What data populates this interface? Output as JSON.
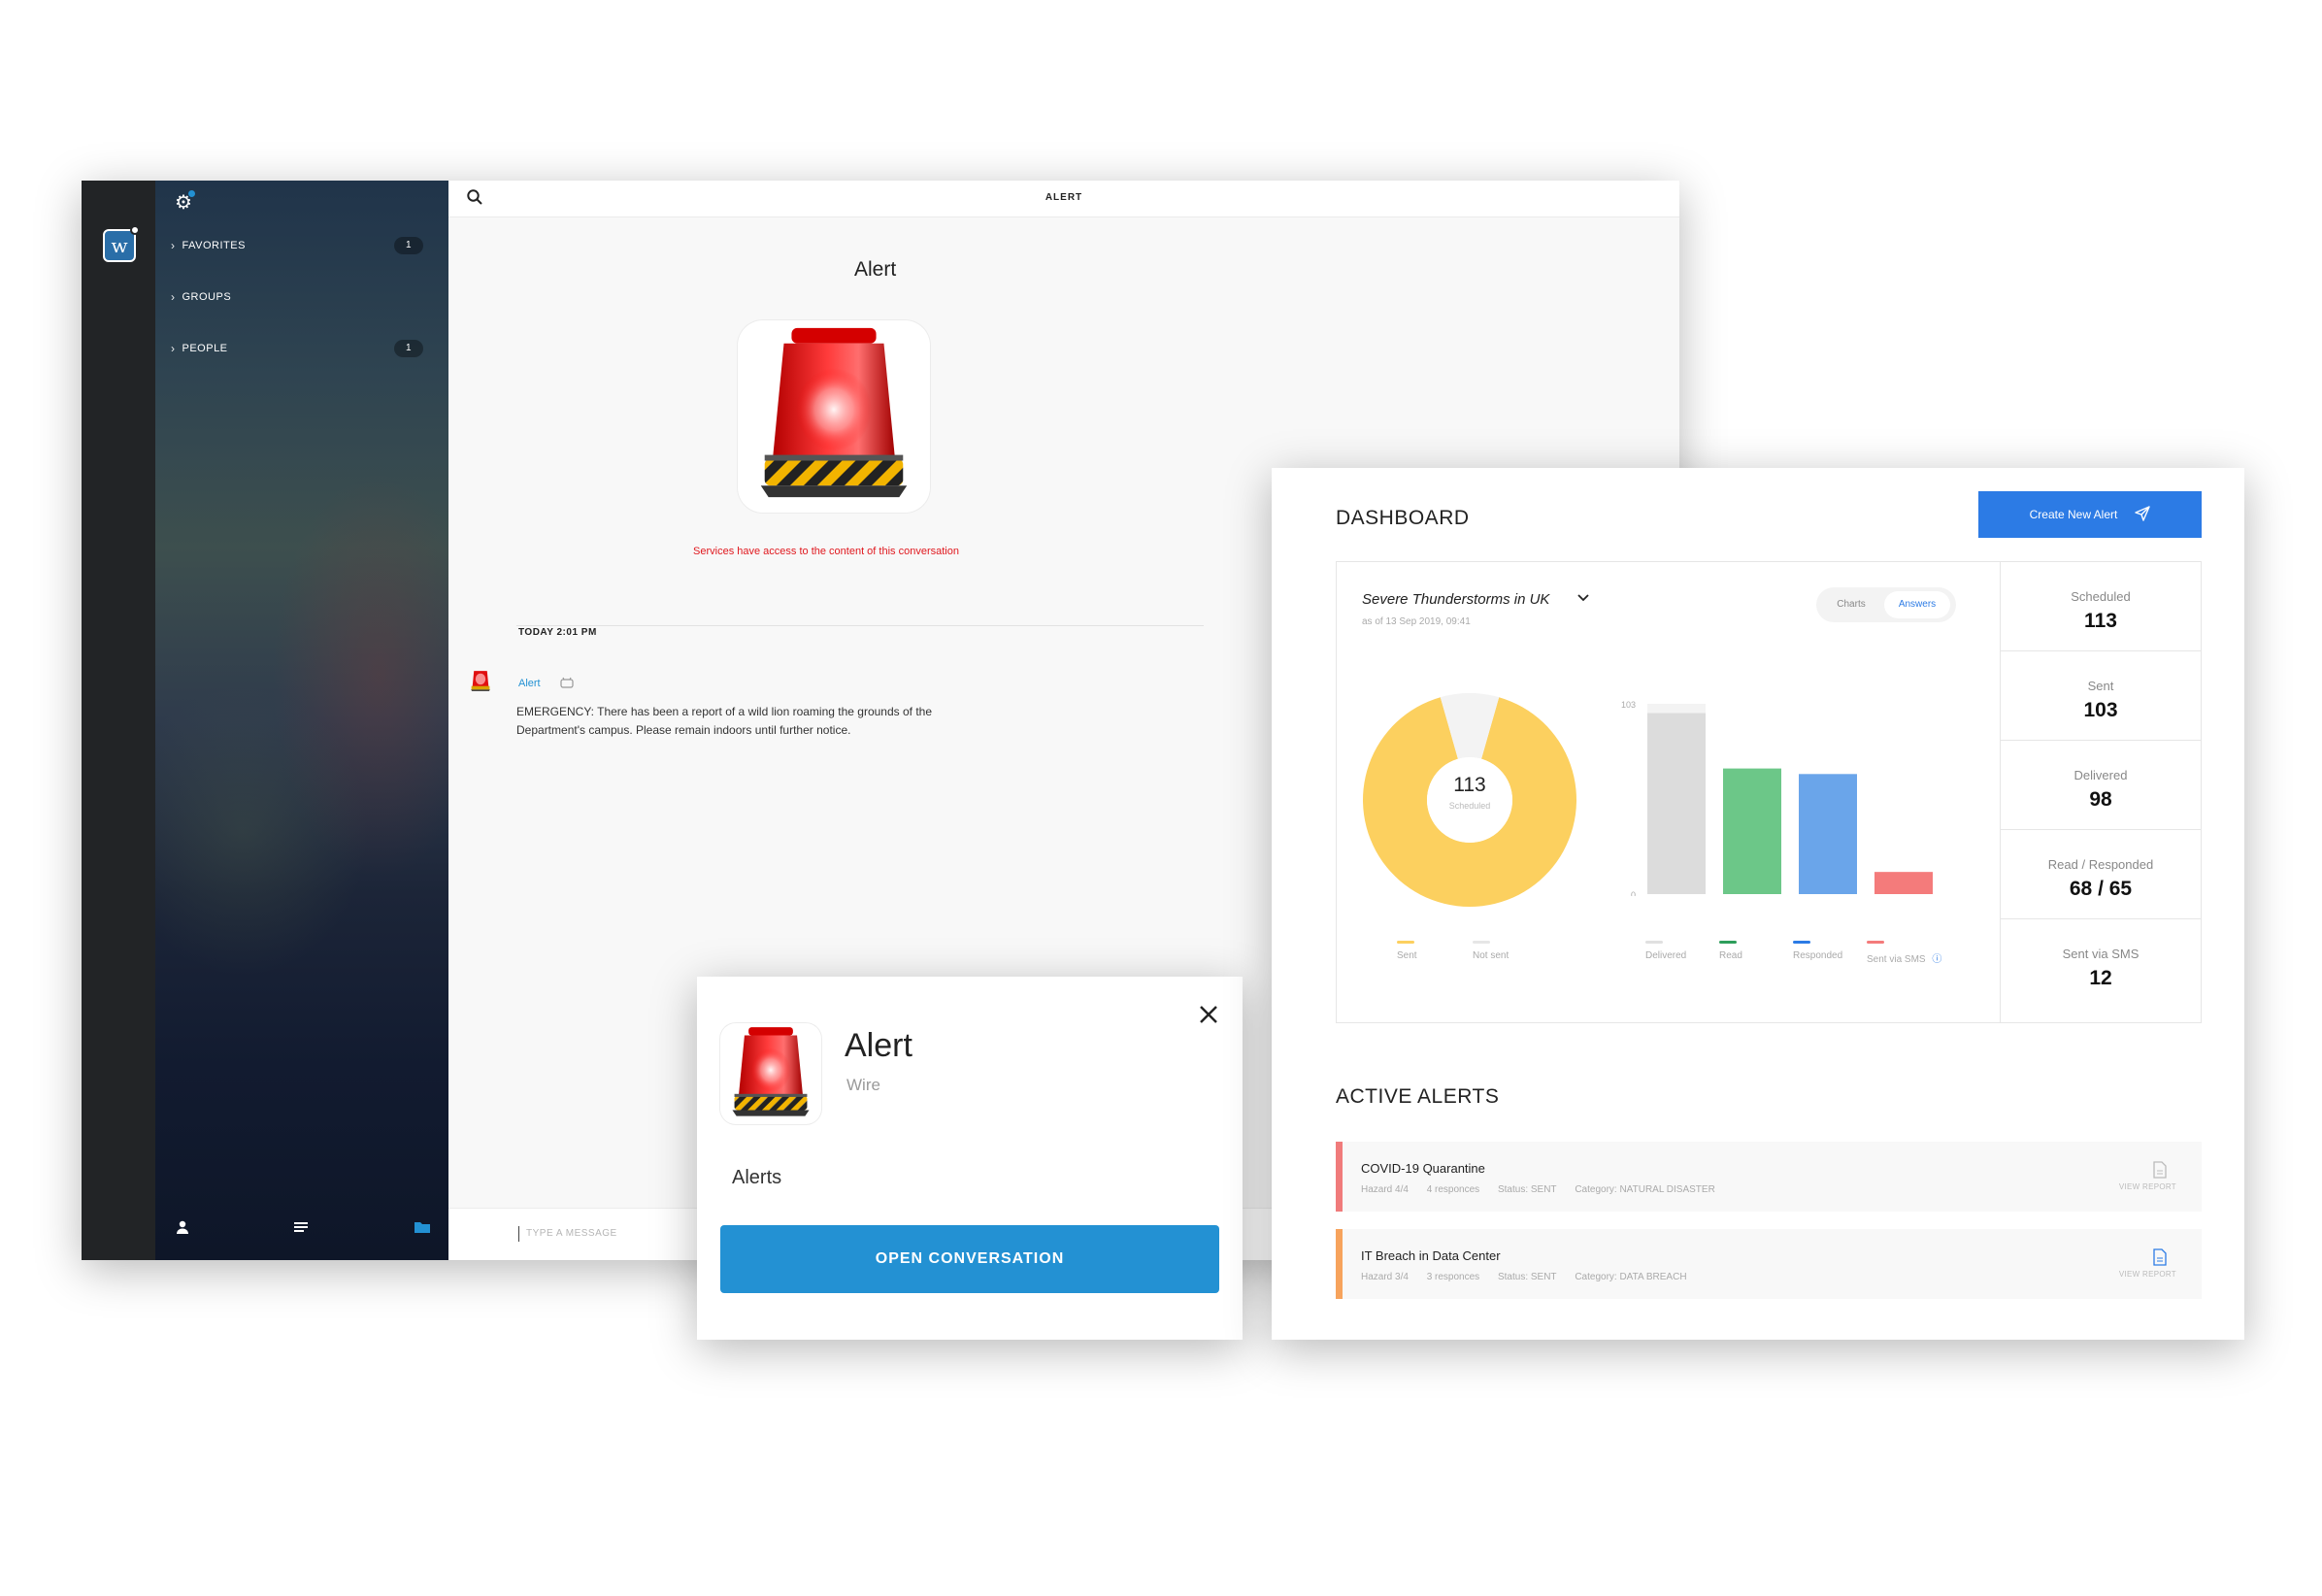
{
  "wire": {
    "logo_letter": "w",
    "sidebar": {
      "items": [
        {
          "label": "FAVORITES",
          "count": "1"
        },
        {
          "label": "GROUPS",
          "count": ""
        },
        {
          "label": "PEOPLE",
          "count": "1"
        }
      ],
      "bottom_icons": [
        "user-icon",
        "list-icon",
        "folder-icon"
      ]
    },
    "top_title": "ALERT",
    "conversation_name": "Alert",
    "services_note": "Services have access to the content of this conversation",
    "day_label": "TODAY 2:01 PM",
    "message": {
      "sender": "Alert",
      "text": "EMERGENCY: There has been a report of a wild lion roaming the grounds of the Department's campus. Please remain indoors until further notice."
    },
    "composer_placeholder": "TYPE A MESSAGE"
  },
  "popup": {
    "title": "Alert",
    "subtitle": "Wire",
    "label": "Alerts",
    "button": "OPEN CONVERSATION"
  },
  "dashboard": {
    "title": "DASHBOARD",
    "create_button": "Create New Alert",
    "colors": {
      "accent": "#2c7be5",
      "sent": "#fcd05f",
      "not_sent": "#f3f3f3",
      "read": "#6cc788",
      "responded": "#6aa5ea",
      "sms": "#f47b7b"
    },
    "event": {
      "title": "Severe Thunderstorms in UK",
      "subtitle": "as of 13 Sep 2019, 09:41",
      "toggle": [
        "Charts",
        "Answers"
      ],
      "active_toggle": "Answers"
    },
    "stats": [
      {
        "label": "Scheduled",
        "value": "113"
      },
      {
        "label": "Sent",
        "value": "103"
      },
      {
        "label": "Delivered",
        "value": "98"
      },
      {
        "label": "Read / Responded",
        "value": "68 / 65"
      },
      {
        "label": "Sent via SMS",
        "value": "12"
      }
    ],
    "donut_center": {
      "value": "113",
      "label": "Scheduled"
    },
    "donut_legend": [
      "Sent",
      "Not sent"
    ],
    "bar_legend": [
      "Delivered",
      "Read",
      "Responded",
      "Sent via SMS"
    ],
    "active_alerts_title": "ACTIVE ALERTS",
    "alerts": [
      {
        "title": "COVID-19 Quarantine",
        "hazard": "Hazard 4/4",
        "responses": "4 responces",
        "status": "Status: SENT",
        "category": "Category: NATURAL DISASTER",
        "report": "VIEW REPORT",
        "color": "#f07b7b"
      },
      {
        "title": "IT Breach in Data Center",
        "hazard": "Hazard 3/4",
        "responses": "3 responces",
        "status": "Status: SENT",
        "category": "Category: DATA BREACH",
        "report": "VIEW REPORT",
        "color": "#f7a35c"
      }
    ]
  },
  "chart_data": [
    {
      "type": "pie",
      "categories": [
        "Sent",
        "Not sent"
      ],
      "values": [
        103,
        10
      ],
      "center_value": "113",
      "center_label": "Scheduled"
    },
    {
      "type": "bar",
      "categories": [
        "Delivered",
        "Read",
        "Responded",
        "Sent via SMS"
      ],
      "values": [
        98,
        68,
        65,
        12
      ],
      "background_max": 103,
      "ylim": [
        0,
        103
      ],
      "yticks": [
        "0",
        "103"
      ]
    }
  ]
}
